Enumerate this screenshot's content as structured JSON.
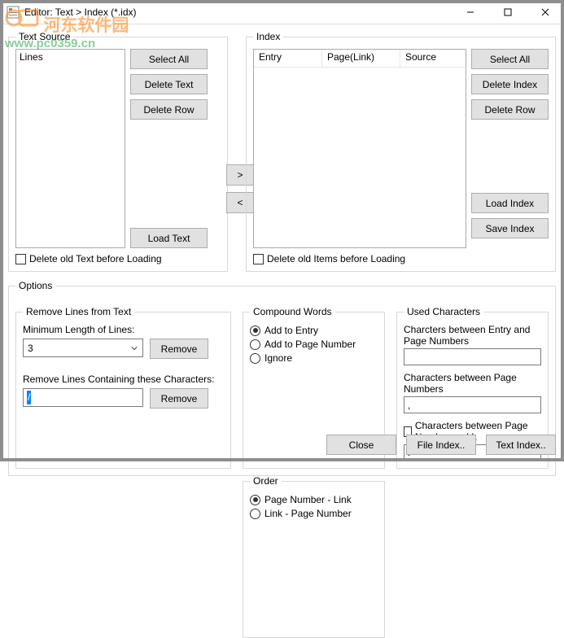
{
  "window": {
    "title": "Editor: Text > Index (*.idx)",
    "minimize": "—",
    "maximize": "☐",
    "close": "✕"
  },
  "textSource": {
    "legend": "Text Source",
    "listHeader": "Lines",
    "buttons": {
      "selectAll": "Select All",
      "deleteText": "Delete Text",
      "deleteRow": "Delete Row",
      "loadText": "Load Text"
    },
    "deleteOld": "Delete old Text before Loading"
  },
  "midArrows": {
    "right": ">",
    "left": "<"
  },
  "index": {
    "legend": "Index",
    "cols": {
      "entry": "Entry",
      "page": "Page(Link)",
      "source": "Source"
    },
    "buttons": {
      "selectAll": "Select All",
      "deleteIndex": "Delete Index",
      "deleteRow": "Delete Row",
      "loadIndex": "Load Index",
      "saveIndex": "Save Index"
    },
    "deleteOld": "Delete old Items before Loading"
  },
  "options": {
    "legend": "Options",
    "remove": {
      "legend": "Remove Lines from Text",
      "minLen": "Minimum Length of Lines:",
      "minLenValue": "3",
      "removeBtn": "Remove",
      "charsLabel": "Remove Lines Containing these Characters:",
      "charsValue": "/"
    },
    "compound": {
      "legend": "Compound Words",
      "addEntry": "Add to Entry",
      "addPage": "Add to Page Number",
      "ignore": "Ignore"
    },
    "order": {
      "legend": "Order",
      "pnLink": "Page Number - Link",
      "linkPn": "Link - Page Number"
    },
    "used": {
      "legend": "Used Characters",
      "lbl1": "Charcters between Entry and Page Numbers",
      "val1": "",
      "lbl2": "Characters between Page Numbers",
      "val2": ",",
      "chk": "Characters between Page Number and L",
      "val3": ">"
    }
  },
  "bottom": {
    "close": "Close",
    "fileIndex": "File Index..",
    "textIndex": "Text Index.."
  },
  "watermark": {
    "line1": "河东软件园",
    "line2": "www.pc0359.cn"
  }
}
